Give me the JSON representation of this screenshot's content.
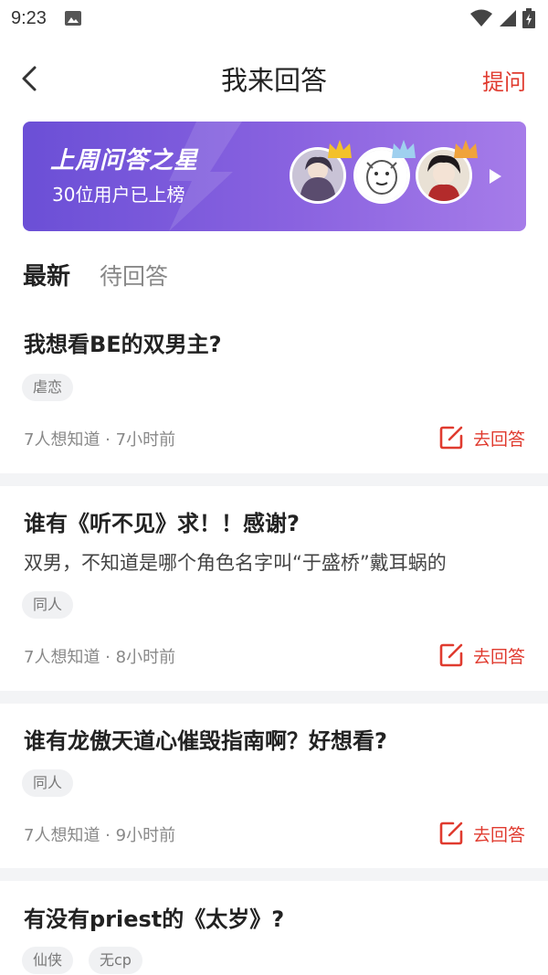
{
  "statusbar": {
    "time": "9:23"
  },
  "nav": {
    "title": "我来回答",
    "ask_label": "提问"
  },
  "banner": {
    "title": "上周问答之星",
    "subtitle": "30位用户已上榜",
    "crown_colors": [
      "#f3c12b",
      "#9fd0ef",
      "#f0a33c"
    ]
  },
  "tabs": {
    "active": "最新",
    "other": "待回答"
  },
  "questions": [
    {
      "title": "我想看BE的双男主?",
      "desc": "",
      "tags": [
        "虐恋"
      ],
      "meta": "7人想知道 · 7小时前",
      "answer_label": "去回答"
    },
    {
      "title": "谁有《听不见》求！！感谢?",
      "desc": "双男，不知道是哪个角色名字叫“于盛桥”戴耳蜗的",
      "tags": [
        "同人"
      ],
      "meta": "7人想知道 · 8小时前",
      "answer_label": "去回答"
    },
    {
      "title": "谁有龙傲天道心催毁指南啊？好想看?",
      "desc": "",
      "tags": [
        "同人"
      ],
      "meta": "7人想知道 · 9小时前",
      "answer_label": "去回答"
    },
    {
      "title": "有没有priest的《太岁》?",
      "desc": "",
      "tags": [
        "仙侠",
        "无cp"
      ],
      "meta": "",
      "answer_label": ""
    }
  ],
  "colors": {
    "accent": "#e03b2f",
    "banner_start": "#6b4fd6",
    "banner_end": "#a67ce9"
  }
}
